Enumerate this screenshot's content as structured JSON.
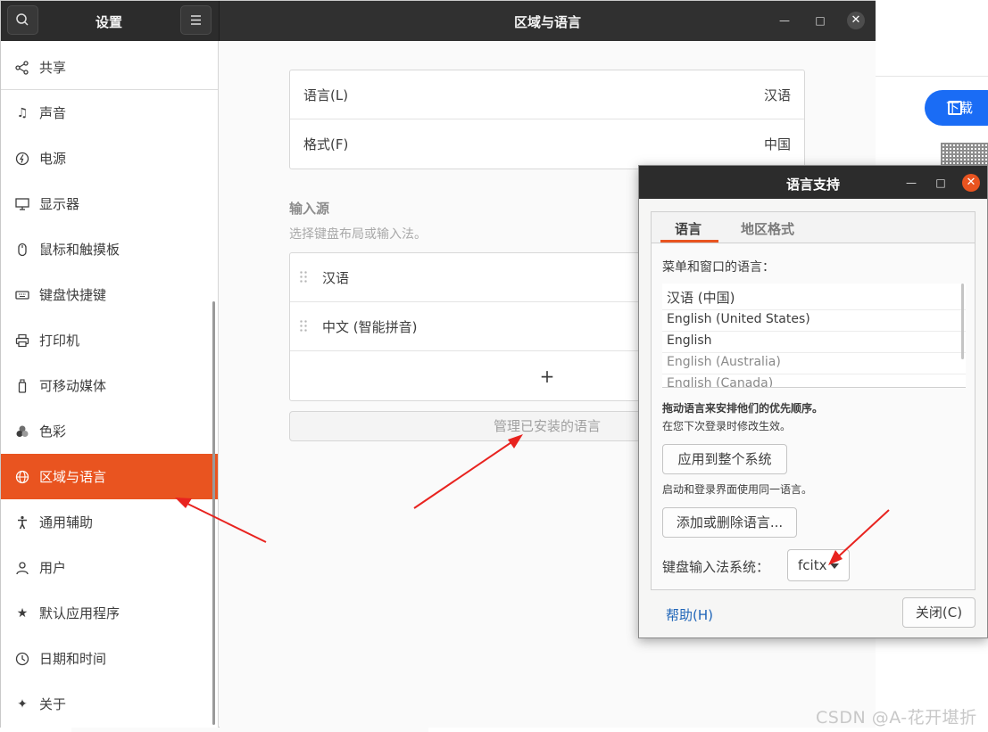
{
  "background_page": {
    "download_label": "下载"
  },
  "settings": {
    "sidebar_title": "设置",
    "window_title": "区域与语言",
    "nav": [
      {
        "label": "共享",
        "icon": "share-icon"
      },
      {
        "label": "声音",
        "icon": "music-note-icon"
      },
      {
        "label": "电源",
        "icon": "power-icon"
      },
      {
        "label": "显示器",
        "icon": "display-icon"
      },
      {
        "label": "鼠标和触摸板",
        "icon": "mouse-icon"
      },
      {
        "label": "键盘快捷键",
        "icon": "keyboard-icon"
      },
      {
        "label": "打印机",
        "icon": "printer-icon"
      },
      {
        "label": "可移动媒体",
        "icon": "usb-drive-icon"
      },
      {
        "label": "色彩",
        "icon": "color-icon"
      },
      {
        "label": "区域与语言",
        "icon": "globe-icon",
        "active": true
      },
      {
        "label": "通用辅助",
        "icon": "accessibility-icon"
      },
      {
        "label": "用户",
        "icon": "user-icon"
      },
      {
        "label": "默认应用程序",
        "icon": "star-icon"
      },
      {
        "label": "日期和时间",
        "icon": "clock-icon"
      },
      {
        "label": "关于",
        "icon": "sparkle-icon"
      }
    ],
    "region": {
      "language_label": "语言(L)",
      "language_value": "汉语",
      "format_label": "格式(F)",
      "format_value": "中国"
    },
    "input_sources": {
      "title": "输入源",
      "subtitle": "选择键盘布局或输入法。",
      "items": [
        "汉语",
        "中文 (智能拼音)"
      ],
      "add_symbol": "+"
    },
    "manage_button": "管理已安装的语言"
  },
  "dialog": {
    "title": "语言支持",
    "tabs": [
      {
        "label": "语言",
        "active": true
      },
      {
        "label": "地区格式",
        "active": false
      }
    ],
    "menu_lang_label": "菜单和窗口的语言：",
    "languages": [
      {
        "label": "汉语 (中国)",
        "dim": false
      },
      {
        "label": "English (United States)",
        "dim": false
      },
      {
        "label": "English",
        "dim": false
      },
      {
        "label": "English (Australia)",
        "dim": true
      },
      {
        "label": "English (Canada)",
        "dim": true
      }
    ],
    "drag_hint": "拖动语言来安排他们的优先顺序。",
    "next_login_hint": "在您下次登录时修改生效。",
    "apply_button": "应用到整个系统",
    "apply_hint": "启动和登录界面使用同一语言。",
    "add_remove_button": "添加或删除语言...",
    "input_system_label": "键盘输入法系统：",
    "input_system_value": "fcitx",
    "help_link": "帮助(H)",
    "close_button": "关闭(C)"
  },
  "watermark": "CSDN @A-花开堪折",
  "colors": {
    "accent": "#e95420",
    "header_dark": "#2c2c2c",
    "annotation_red": "#e8231f"
  }
}
